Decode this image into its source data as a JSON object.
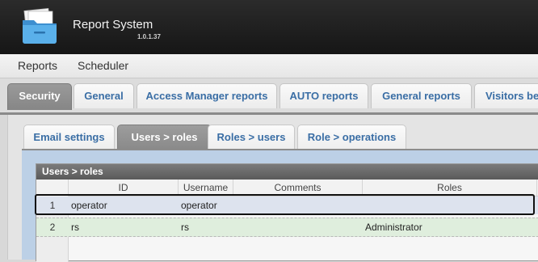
{
  "app": {
    "title": "Report System",
    "version": "1.0.1.37",
    "icon": "folder-icon"
  },
  "menu": {
    "items": [
      {
        "label": "Reports"
      },
      {
        "label": "Scheduler"
      }
    ]
  },
  "main_tabs": [
    {
      "label": "Security",
      "active": true
    },
    {
      "label": "General",
      "active": false
    },
    {
      "label": "Access Manager reports",
      "active": false
    },
    {
      "label": "AUTO reports",
      "active": false
    },
    {
      "label": "General reports",
      "active": false
    },
    {
      "label": "Visitors be",
      "active": false
    }
  ],
  "sub_tabs": [
    {
      "label": "Email settings",
      "active": false
    },
    {
      "label": "Users > roles",
      "active": true
    },
    {
      "label": "Roles > users",
      "active": false
    },
    {
      "label": "Role > operations",
      "active": false
    }
  ],
  "grid": {
    "caption": "Users > roles",
    "columns": [
      "ID",
      "Username",
      "Comments",
      "Roles"
    ],
    "rows": [
      {
        "num": "1",
        "id": "operator",
        "username": "operator",
        "comments": "",
        "roles": "",
        "selected": true
      },
      {
        "num": "2",
        "id": "rs",
        "username": "rs",
        "comments": "",
        "roles": "Administrator",
        "selected": false
      }
    ]
  },
  "colors": {
    "header_bg": "#1f1f1f",
    "tab_text": "#3a6ea5",
    "active_tab_bg": "#8e8e8e",
    "panel_bg": "#bcd0e6",
    "selected_row_bg": "#dde3ee",
    "alt_row_bg": "#dfeedd"
  }
}
